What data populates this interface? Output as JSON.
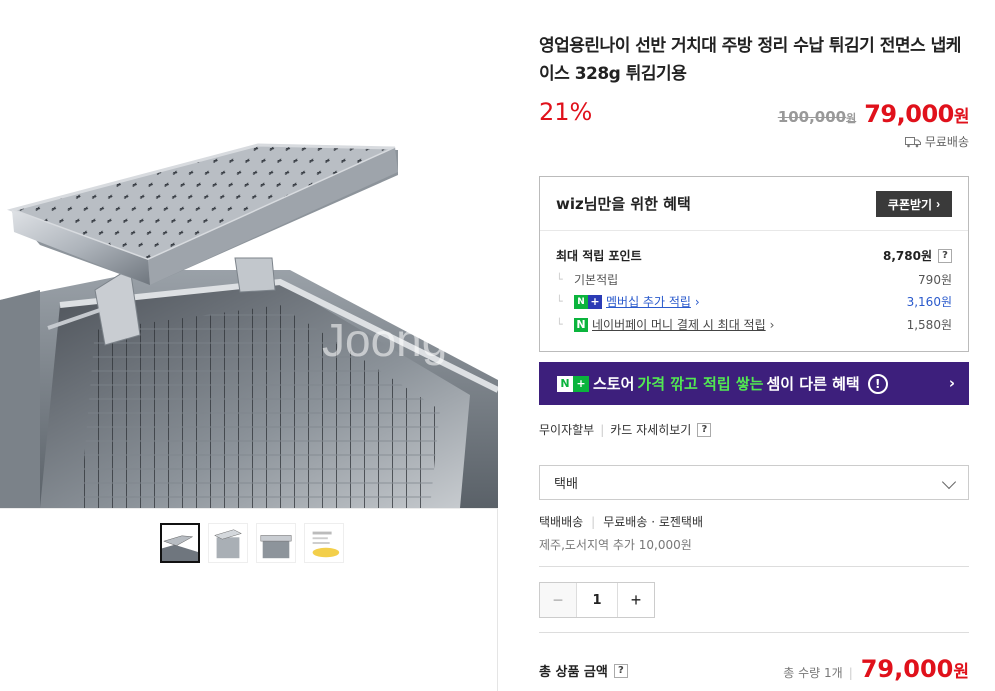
{
  "gallery": {
    "watermark": "Joong",
    "thumbnail_count": 4,
    "thumbnails": [
      {
        "name": "thumb-1",
        "active": true
      },
      {
        "name": "thumb-2",
        "active": false
      },
      {
        "name": "thumb-3",
        "active": false
      },
      {
        "name": "thumb-4",
        "active": false
      }
    ]
  },
  "product": {
    "title": "영업용린나이 선반 거치대 주방 정리 수납 튀김기 전면스 냅케이스 328g 튀김기용",
    "discount": "21%",
    "original_price": "100,000",
    "original_unit": "원",
    "sale_price": "79,000",
    "sale_unit": "원",
    "shipping_note": "무료배송"
  },
  "benefits": {
    "title": "wiz님만을 위한 혜택",
    "coupon_button": "쿠폰받기",
    "max_points_label": "최대 적립 포인트",
    "max_points_value": "8,780원",
    "help": "?",
    "rows": [
      {
        "label": "기본적립",
        "value": "790원"
      },
      {
        "label": "멤버십 추가 적립",
        "value": "3,160원"
      },
      {
        "label": "네이버페이 머니 결제 시 최대 적립",
        "value": "1,580원"
      }
    ]
  },
  "store_banner": {
    "prefix": "스토어",
    "highlight": "가격 깎고 적립 쌓는",
    "suffix": "셈이 다른 혜택",
    "badge_n": "N",
    "badge_plus": "+"
  },
  "payment": {
    "installment": "무이자할부",
    "card_details": "카드 자세히보기",
    "help": "?"
  },
  "delivery": {
    "selected": "택배",
    "method": "택배배송",
    "fee": "무료배송 · 로젠택배",
    "extra": "제주,도서지역 추가 10,000원"
  },
  "quantity": {
    "minus": "−",
    "value": "1",
    "plus": "+"
  },
  "total": {
    "label": "총 상품 금액",
    "help": "?",
    "qty_text": "총 수량 1개",
    "price": "79,000",
    "unit": "원"
  },
  "colors": {
    "sale_red": "#e0111b",
    "banner_purple": "#3d1f7c",
    "naver_green": "#0bb43d",
    "link_blue": "#2a5acc"
  }
}
